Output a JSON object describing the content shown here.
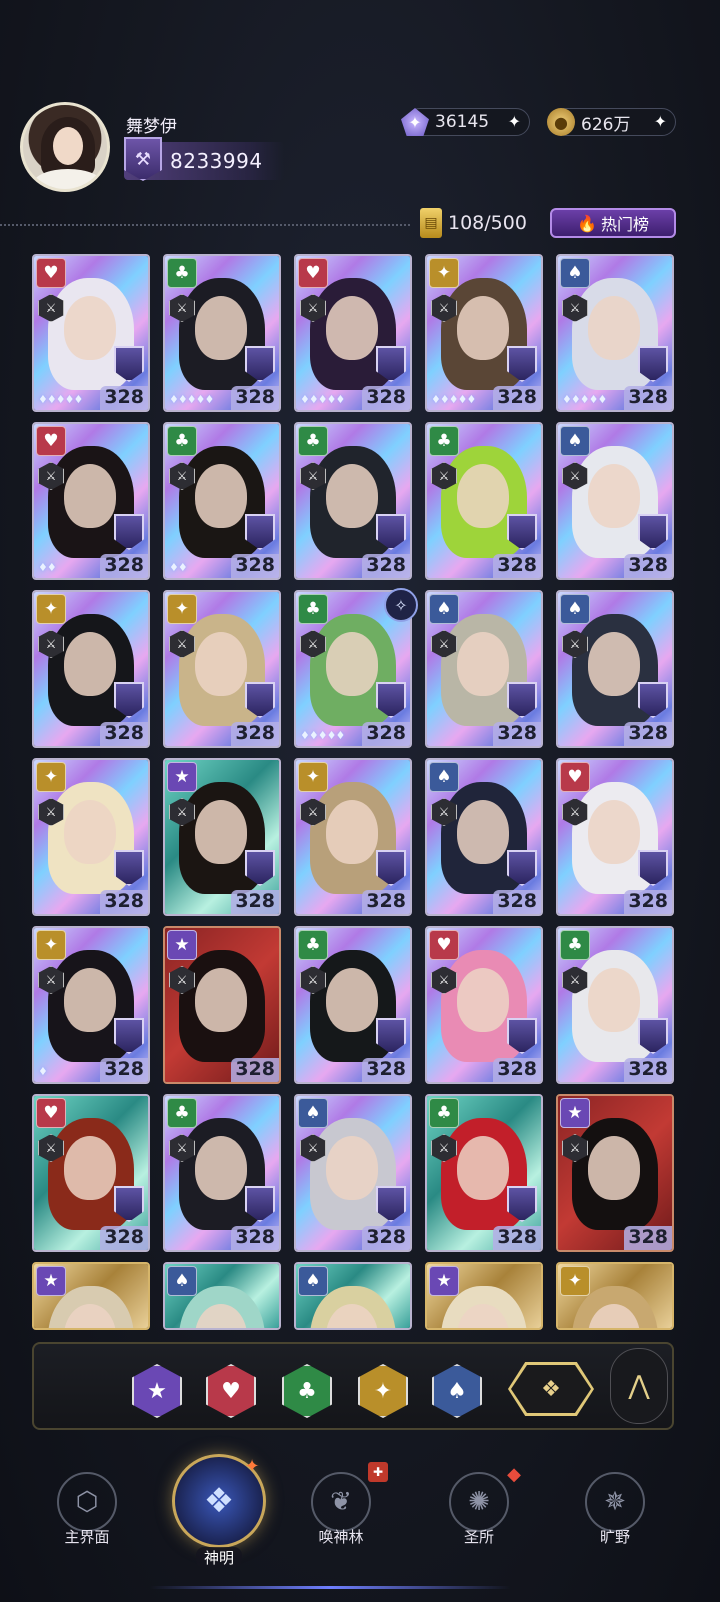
{
  "header": {
    "username": "舞梦伊",
    "power": "8233994",
    "crystal": "36145",
    "gold": "626万",
    "card_count": "108/500",
    "hot_button": "热门榜"
  },
  "colors": {
    "heart": "#b8394a",
    "club": "#2f8a46",
    "diamond": "#b98f2a",
    "spade": "#3b5a9a",
    "star": "#6a48b4",
    "accent_gold": "#e0c878"
  },
  "cards": [
    {
      "suit": "heart",
      "level": "328",
      "stars": "♦♦♦♦♦",
      "bg": "holo",
      "hair": "#e9e6f0"
    },
    {
      "suit": "club",
      "level": "328",
      "stars": "♦♦♦♦♦",
      "bg": "holo",
      "hair": "#1c1c24"
    },
    {
      "suit": "heart",
      "level": "328",
      "stars": "♦♦♦♦♦",
      "bg": "holo",
      "hair": "#2a1c38"
    },
    {
      "suit": "diamond",
      "level": "328",
      "stars": "♦♦♦♦♦",
      "bg": "holo",
      "hair": "#5a4636"
    },
    {
      "suit": "spade",
      "level": "328",
      "stars": "♦♦♦♦♦",
      "bg": "holo",
      "hair": "#d8dbe8"
    },
    {
      "suit": "heart",
      "level": "328",
      "stars": "♦♦",
      "bg": "holo",
      "hair": "#1a1416"
    },
    {
      "suit": "club",
      "level": "328",
      "stars": "♦♦",
      "bg": "holo",
      "hair": "#1a1614"
    },
    {
      "suit": "club",
      "level": "328",
      "stars": "",
      "bg": "holo",
      "hair": "#20242c"
    },
    {
      "suit": "club",
      "level": "328",
      "stars": "",
      "bg": "holo",
      "hair": "#9ed43a"
    },
    {
      "suit": "spade",
      "level": "328",
      "stars": "",
      "bg": "holo",
      "hair": "#e6e8ee"
    },
    {
      "suit": "diamond",
      "level": "328",
      "stars": "",
      "bg": "holo",
      "hair": "#15161a"
    },
    {
      "suit": "diamond",
      "level": "328",
      "stars": "",
      "bg": "holo",
      "hair": "#c9b48a"
    },
    {
      "suit": "club",
      "level": "328",
      "stars": "♦♦♦♦♦",
      "bg": "holo",
      "hair": "#6fae62"
    },
    {
      "suit": "spade",
      "level": "328",
      "stars": "",
      "bg": "holo",
      "hair": "#b9b6a6"
    },
    {
      "suit": "spade",
      "level": "328",
      "stars": "",
      "bg": "holo",
      "hair": "#2a3040"
    },
    {
      "suit": "diamond",
      "level": "328",
      "stars": "",
      "bg": "holo",
      "hair": "#efe3c2"
    },
    {
      "suit": "star",
      "level": "328",
      "stars": "",
      "bg": "teal",
      "hair": "#1b1512"
    },
    {
      "suit": "diamond",
      "level": "328",
      "stars": "",
      "bg": "holo",
      "hair": "#b8a07a"
    },
    {
      "suit": "spade",
      "level": "328",
      "stars": "",
      "bg": "holo",
      "hair": "#20253a"
    },
    {
      "suit": "heart",
      "level": "328",
      "stars": "",
      "bg": "holo",
      "hair": "#ecebf0"
    },
    {
      "suit": "diamond",
      "level": "328",
      "stars": "♦",
      "bg": "holo",
      "hair": "#17141a"
    },
    {
      "suit": "star",
      "level": "328",
      "stars": "",
      "bg": "red",
      "hair": "#1a1010"
    },
    {
      "suit": "club",
      "level": "328",
      "stars": "",
      "bg": "holo",
      "hair": "#15181a"
    },
    {
      "suit": "heart",
      "level": "328",
      "stars": "",
      "bg": "holo",
      "hair": "#e98bb4"
    },
    {
      "suit": "club",
      "level": "328",
      "stars": "",
      "bg": "holo",
      "hair": "#e8e8ec"
    },
    {
      "suit": "heart",
      "level": "328",
      "stars": "",
      "bg": "teal",
      "hair": "#8a2a1a"
    },
    {
      "suit": "club",
      "level": "328",
      "stars": "",
      "bg": "holo",
      "hair": "#1c1c24"
    },
    {
      "suit": "spade",
      "level": "328",
      "stars": "",
      "bg": "holo",
      "hair": "#c8c8d0"
    },
    {
      "suit": "club",
      "level": "328",
      "stars": "",
      "bg": "teal",
      "hair": "#c21f2a"
    },
    {
      "suit": "star",
      "level": "328",
      "stars": "",
      "bg": "red",
      "hair": "#141010"
    },
    {
      "suit": "star",
      "level": "",
      "stars": "",
      "bg": "gold",
      "hair": "#d8cbb0"
    },
    {
      "suit": "spade",
      "level": "",
      "stars": "",
      "bg": "teal",
      "hair": "#9fd6c8"
    },
    {
      "suit": "spade",
      "level": "",
      "stars": "",
      "bg": "teal",
      "hair": "#d9d0a0"
    },
    {
      "suit": "star",
      "level": "",
      "stars": "",
      "bg": "gold",
      "hair": "#e8dcc0"
    },
    {
      "suit": "diamond",
      "level": "",
      "stars": "",
      "bg": "gold",
      "hair": "#c8a870"
    }
  ],
  "filters": [
    {
      "name": "star",
      "icon": "star-icon",
      "glyph": "★"
    },
    {
      "name": "heart",
      "icon": "heart-icon",
      "glyph": "♥"
    },
    {
      "name": "club",
      "icon": "club-icon",
      "glyph": "♣"
    },
    {
      "name": "diamond",
      "icon": "diamond-icon",
      "glyph": "✦"
    },
    {
      "name": "spade",
      "icon": "spade-icon",
      "glyph": "♠"
    }
  ],
  "nav": {
    "item1": "主界面",
    "item2": "神明",
    "item3": "唤神林",
    "item4": "圣所",
    "item5": "旷野"
  }
}
